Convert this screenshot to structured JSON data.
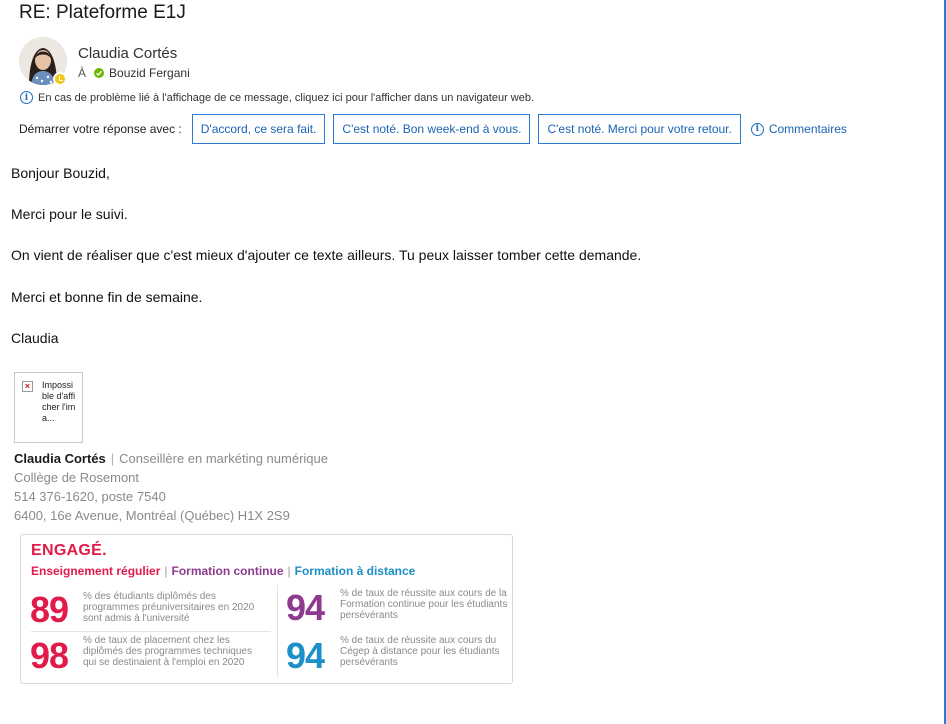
{
  "email": {
    "subject": "RE: Plateforme E1J",
    "sender": "Claudia Cortés",
    "to_label": "À",
    "recipient": "Bouzid Fergani",
    "info_message": "En cas de problème lié à l'affichage de ce message, cliquez ici pour l'afficher dans un navigateur web."
  },
  "reply": {
    "label": "Démarrer votre réponse avec :",
    "suggestions": [
      "D'accord, ce sera fait.",
      "C'est noté. Bon week-end à vous.",
      "C'est noté. Merci pour votre retour."
    ],
    "comments_label": "Commentaires"
  },
  "body": {
    "greeting": "Bonjour Bouzid,",
    "line1": "Merci pour le suivi.",
    "line2": "On vient de réaliser que c'est mieux d'ajouter ce texte ailleurs. Tu peux laisser tomber cette demande.",
    "line3": "Merci et bonne fin de semaine.",
    "closing": "Claudia"
  },
  "signature": {
    "broken_image_alt": "Impossible d'afficher l'ima...",
    "name": "Claudia Cortés",
    "separator": "|",
    "title": "Conseillère en markéting numérique",
    "org": "Collège de Rosemont",
    "phone": "514 376-1620, poste 7540",
    "address": "6400, 16e Avenue, Montréal (Québec)  H1X 2S9"
  },
  "banner": {
    "title": "ENGAGÉ.",
    "tags": [
      "Enseignement régulier",
      "Formation continue",
      "Formation à distance"
    ],
    "tag_colors": [
      "#e11b49",
      "#8e3a8f",
      "#1d8fc9"
    ],
    "stats": [
      {
        "number": "89",
        "color": "#e11b49",
        "desc": "% des étudiants diplômés des programmes préuniversitaires en 2020 sont admis à l'université"
      },
      {
        "number": "98",
        "color": "#e11b49",
        "desc": "% de taux de placement chez les diplômés des programmes techniques qui se destinaient à l'emploi en 2020"
      },
      {
        "number": "94",
        "color": "#8e3a8f",
        "desc": "% de taux de réussite aux cours de la Formation continue pour les étudiants persévérants"
      },
      {
        "number": "94",
        "color": "#1d8fc9",
        "desc": "% de taux de réussite aux cours du Cégep à distance pour les étudiants persévérants"
      }
    ]
  },
  "icons": [
    "avatar-photo",
    "presence-away-icon",
    "available-check-icon",
    "info-icon",
    "broken-image-icon"
  ],
  "colors": {
    "accent": "#1a63b3",
    "presence": "#f2c811",
    "available": "#6bb700"
  }
}
